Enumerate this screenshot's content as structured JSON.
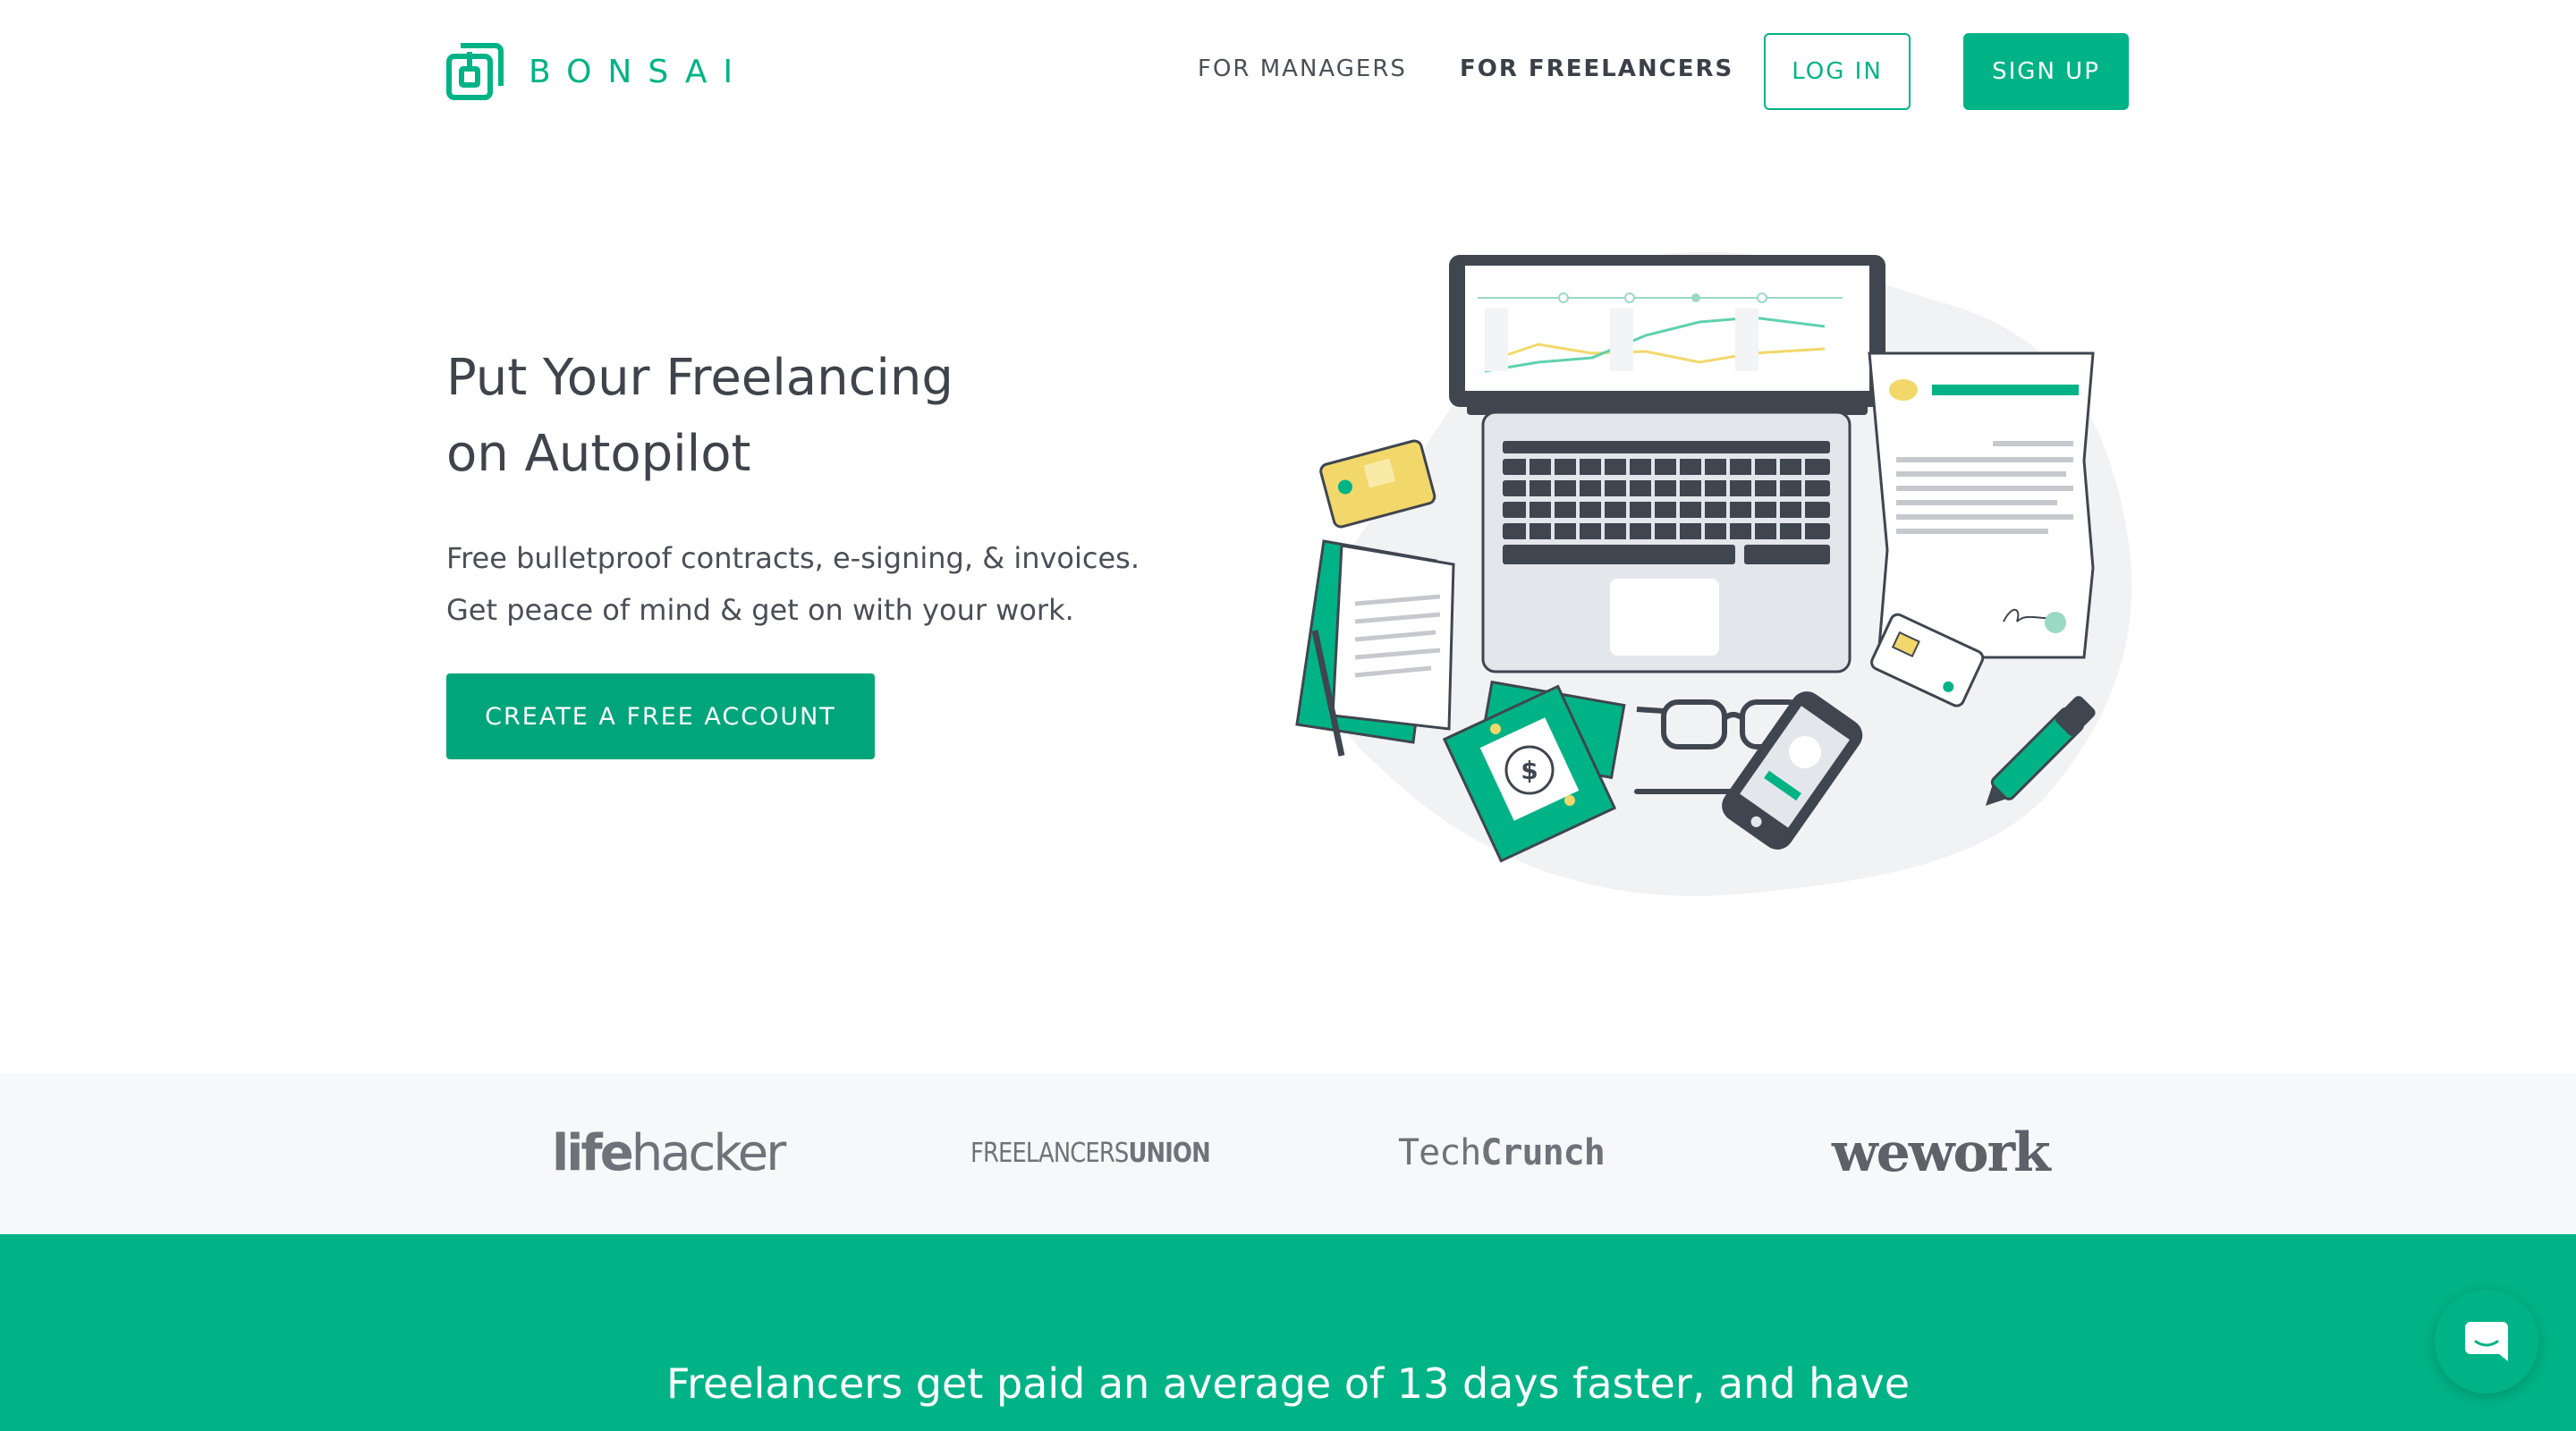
{
  "brand": {
    "name": "BONSAI",
    "color": "#00b386"
  },
  "nav": {
    "managers": "FOR MANAGERS",
    "freelancers": "FOR FREELANCERS",
    "login": "LOG IN",
    "signup": "SIGN UP"
  },
  "hero": {
    "title_line1": "Put Your Freelancing",
    "title_line2": "on Autopilot",
    "sub_line1": "Free bulletproof contracts, e-signing, & invoices.",
    "sub_line2": "Get peace of mind & get on with your work.",
    "cta": "CREATE A FREE ACCOUNT"
  },
  "press": {
    "lifehacker_a": "life",
    "lifehacker_b": "hacker",
    "freelancers_union_a": "FREELANCERS",
    "freelancers_union_b": "UNION",
    "techcrunch_a": "Tech",
    "techcrunch_b": "Crunch",
    "wework": "wework"
  },
  "stats": {
    "headline": "Freelancers get paid an average of 13 days faster, and have"
  },
  "icons": {
    "logo": "bonsai-logo-icon",
    "chat": "chat-icon"
  }
}
